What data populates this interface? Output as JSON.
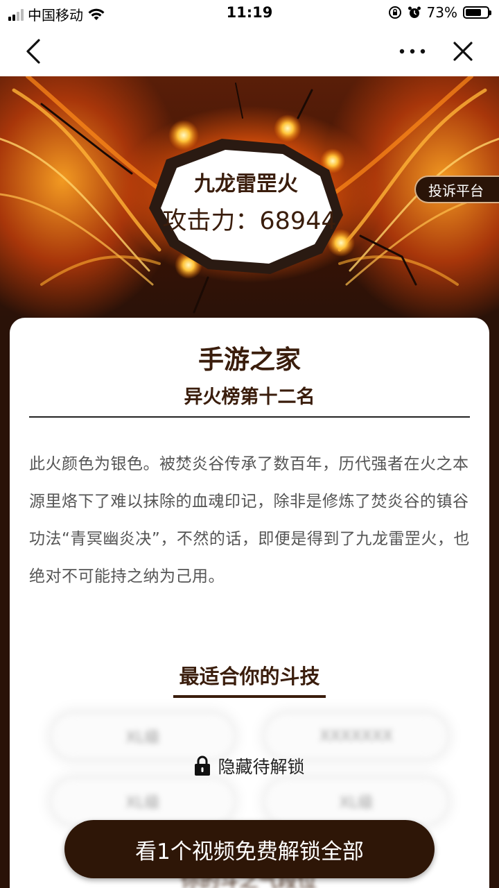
{
  "status_bar": {
    "carrier": "中国移动",
    "time": "11:19",
    "battery_percent": "73%",
    "battery_level": 0.73
  },
  "nav": {
    "back_icon": "chevron-left-icon",
    "more_icon": "more-dots-icon",
    "close_icon": "close-icon"
  },
  "hero": {
    "name": "九龙雷罡火",
    "attack": "攻击力：68944",
    "complaint_label": "投诉平台"
  },
  "card": {
    "title": "手游之家",
    "subtitle": "异火榜第十二名",
    "description": "此火颜色为银色。被焚炎谷传承了数百年，历代强者在火之本源里烙下了难以抹除的血魂印记，除非是修炼了焚炎谷的镇谷功法“青冥幽炎决”，不然的话，即便是得到了九龙雷罡火，也绝对不可能持之纳为己用。",
    "section_title": "最适合你的斗技",
    "locked_label": "隐藏待解锁",
    "blurred_items": [
      "XL级",
      "XXXXXXX",
      "XL级",
      "XL级"
    ],
    "blurred_footer": "你的斗之气段位"
  },
  "unlock_button": "看1个视频免费解锁全部",
  "colors": {
    "brand_dark": "#2e1607",
    "text_brown": "#3a1d0c",
    "body_gray": "#555555"
  }
}
